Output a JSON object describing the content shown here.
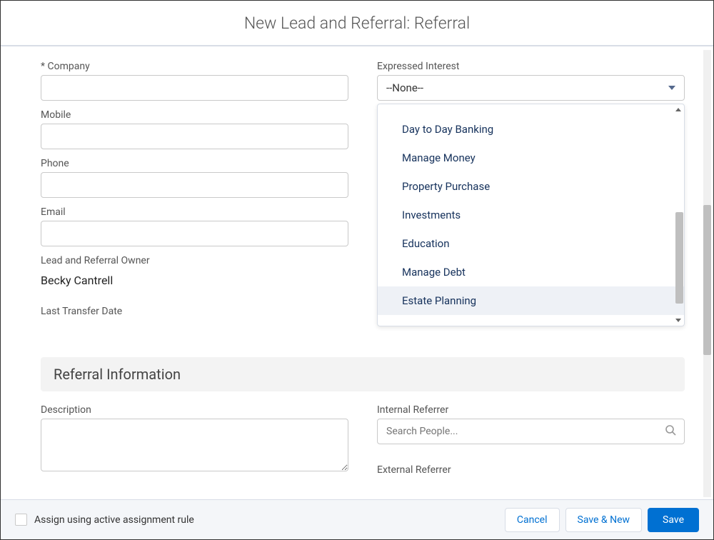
{
  "header": {
    "title": "New Lead and Referral: Referral"
  },
  "fields": {
    "company": {
      "label": "* Company",
      "value": ""
    },
    "mobile": {
      "label": "Mobile",
      "value": ""
    },
    "phone": {
      "label": "Phone",
      "value": ""
    },
    "email": {
      "label": "Email",
      "value": ""
    },
    "owner": {
      "label": "Lead and Referral Owner",
      "value": "Becky Cantrell"
    },
    "lastTransfer": {
      "label": "Last Transfer Date"
    },
    "expressedInterest": {
      "label": "Expressed Interest",
      "selected": "--None--",
      "options": [
        "Day to Day Banking",
        "Manage Money",
        "Property Purchase",
        "Investments",
        "Education",
        "Manage Debt",
        "Estate Planning"
      ],
      "highlightedIndex": 6
    },
    "description": {
      "label": "Description",
      "value": ""
    },
    "internalReferrer": {
      "label": "Internal Referrer",
      "placeholder": "Search People..."
    },
    "externalReferrer": {
      "label": "External Referrer"
    }
  },
  "section": {
    "referralInfo": "Referral Information"
  },
  "footer": {
    "checkboxLabel": "Assign using active assignment rule",
    "cancel": "Cancel",
    "saveNew": "Save & New",
    "save": "Save"
  }
}
